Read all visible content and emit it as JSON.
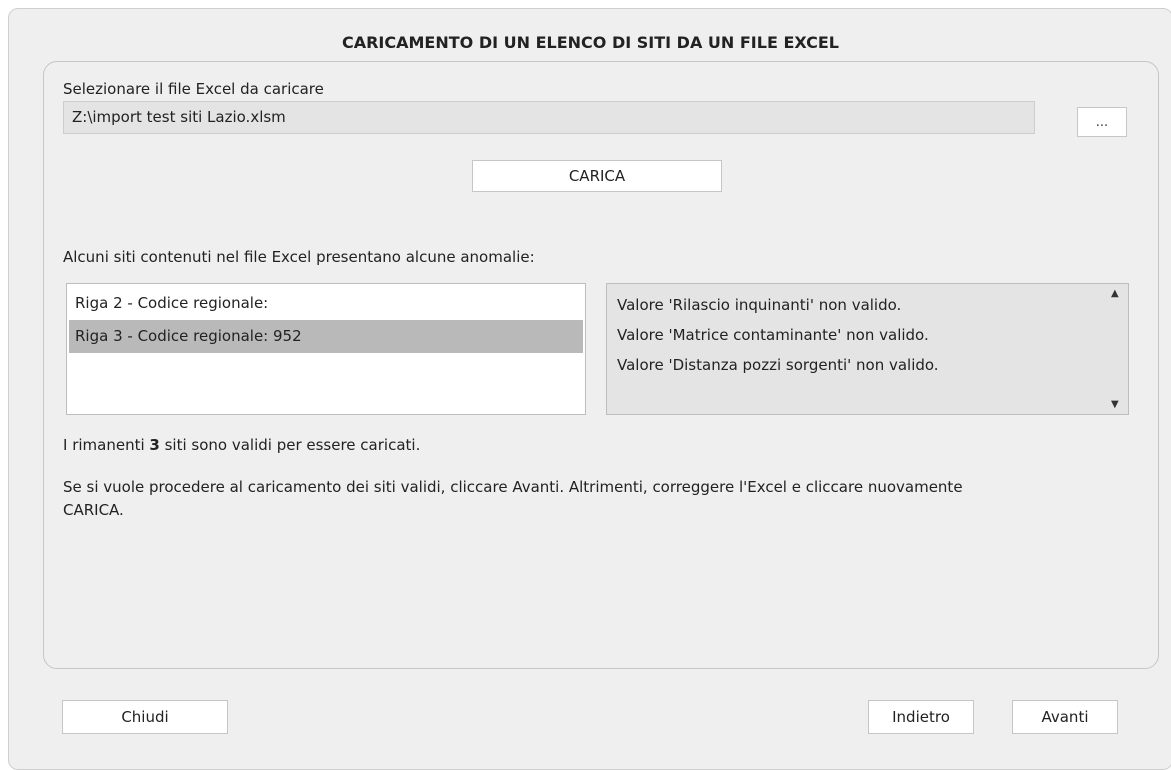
{
  "dialog": {
    "title": "CARICAMENTO DI UN ELENCO DI SITI DA UN FILE EXCEL"
  },
  "file_select": {
    "label": "Selezionare il file Excel da caricare",
    "value": "Z:\\import test siti Lazio.xlsm",
    "browse_label": "..."
  },
  "load_button": "CARICA",
  "anomalies": {
    "intro": "Alcuni siti contenuti nel file Excel presentano alcune anomalie:",
    "rows": [
      {
        "label": "Riga 2 - Codice regionale:",
        "selected": false
      },
      {
        "label": "Riga 3 - Codice regionale: 952",
        "selected": true
      }
    ],
    "details": [
      "Valore 'Rilascio inquinanti' non valido.",
      "Valore 'Matrice contaminante' non valido.",
      "Valore 'Distanza pozzi sorgenti' non valido."
    ]
  },
  "summary": {
    "prefix": "I rimanenti ",
    "count": "3",
    "suffix": " siti sono validi per essere caricati.",
    "instruction_line1": "Se si vuole procedere al caricamento dei siti validi, cliccare Avanti. Altrimenti, correggere l'Excel e cliccare nuovamente",
    "instruction_line2": "CARICA."
  },
  "footer": {
    "close_label": "Chiudi",
    "back_label": "Indietro",
    "next_label": "Avanti"
  },
  "icons": {
    "scroll_up": "triangle-up",
    "scroll_down": "triangle-down"
  }
}
